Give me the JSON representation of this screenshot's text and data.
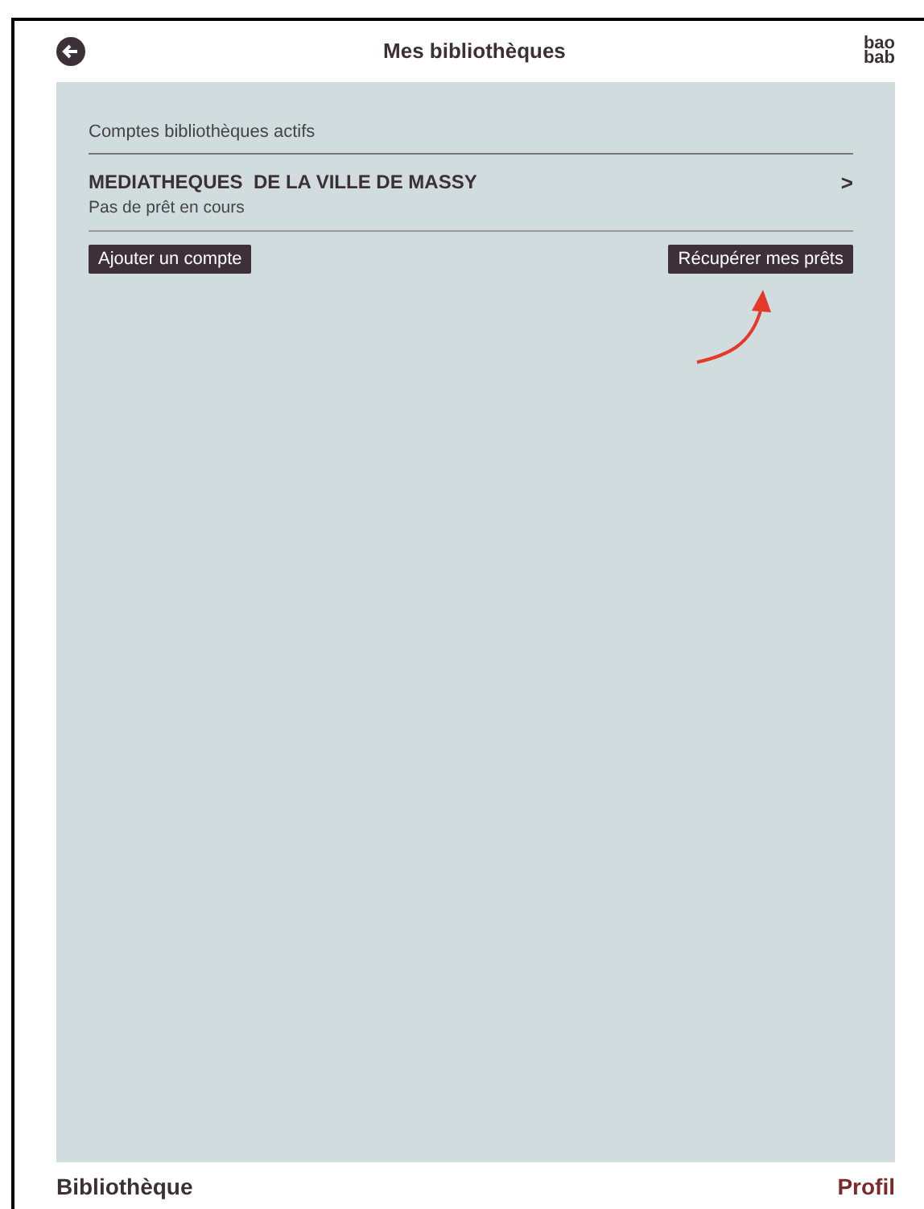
{
  "header": {
    "title": "Mes bibliothèques",
    "logo": [
      "bao",
      "bab"
    ]
  },
  "section": {
    "heading": "Comptes bibliothèques actifs",
    "accounts": [
      {
        "name": "MEDIATHEQUES  DE LA VILLE DE MASSY",
        "status": "Pas de prêt en cours",
        "chevron": ">"
      }
    ],
    "buttons": [
      "Ajouter un compte",
      "Récupérer mes prêts"
    ]
  },
  "tabs": [
    {
      "label": "Bibliothèque",
      "selected": false
    },
    {
      "label": "Profil",
      "selected": true
    }
  ]
}
